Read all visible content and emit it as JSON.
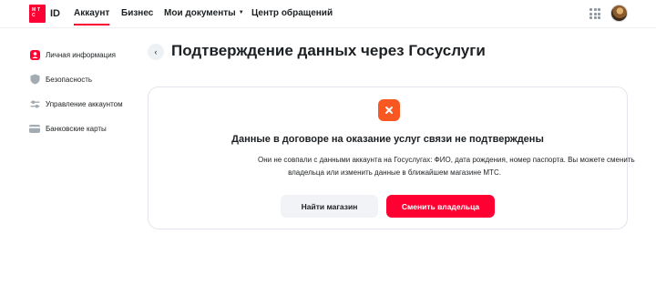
{
  "header": {
    "logo_letters": [
      "М",
      "Т",
      "С"
    ],
    "logo_id": "ID",
    "nav": [
      {
        "label": "Аккаунт"
      },
      {
        "label": "Бизнес"
      },
      {
        "label": "Мои документы"
      },
      {
        "label": "Центр обращений"
      }
    ],
    "apps_icon": "apps-grid-icon",
    "avatar_icon": "user-avatar"
  },
  "sidebar": {
    "items": [
      {
        "label": "Личная информация",
        "icon": "user-icon"
      },
      {
        "label": "Безопасность",
        "icon": "shield-icon"
      },
      {
        "label": "Управление аккаунтом",
        "icon": "sliders-icon"
      },
      {
        "label": "Банковские карты",
        "icon": "card-icon"
      }
    ]
  },
  "main": {
    "back_icon": "chevron-left-icon",
    "title": "Подтверждение данных через Госуслуги",
    "card": {
      "icon": "error-x-icon",
      "heading": "Данные в договоре на оказание услуг связи не подтверждены",
      "text_line1": "Они не совпали с данными аккаунта на Госуслугах: ФИО, дата рождения, номер паспорта. Вы можете сменить",
      "text_line2": "владельца или изменить данные в ближайшем магазине МТС.",
      "btn_secondary": "Найти магазин",
      "btn_primary": "Сменить владельца"
    }
  },
  "colors": {
    "brand_red": "#ff0032",
    "error_orange": "#f95721",
    "text": "#1d2023"
  }
}
